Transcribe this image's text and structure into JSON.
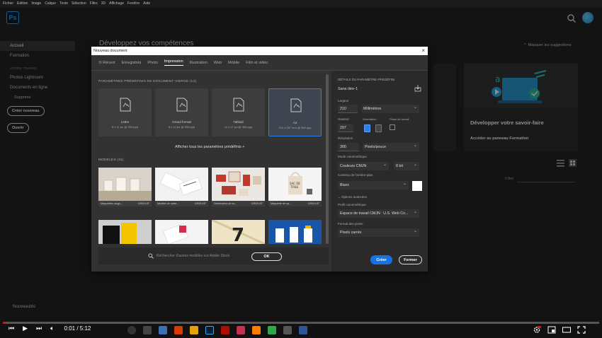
{
  "menubar": [
    "Fichier",
    "Edition",
    "Image",
    "Calque",
    "Texte",
    "Sélection",
    "Filtre",
    "3D",
    "Affichage",
    "Fenêtre",
    "Aide"
  ],
  "app": {
    "logo": "Ps",
    "accent": "#31a8ff"
  },
  "sidebar": {
    "home": "Accueil",
    "learn": "Formation",
    "section": "VOTRE TRAVAIL",
    "items": [
      "Photos Lightroom",
      "Documents en ligne"
    ],
    "deleted": "Supprimé",
    "create": "Créer nouveau",
    "open": "Ouvrir",
    "news": "Nouveautés"
  },
  "home": {
    "heading": "Développez vos compétences",
    "hide_suggestions": "Masquer les suggestions",
    "promo_title": "Développer votre savoir-faire",
    "promo_link": "Accéder au panneau Formation",
    "filter_label": "Filtre"
  },
  "dialog": {
    "title": "Nouveau document",
    "tabs": [
      "Récent",
      "Enregistrés",
      "Photo",
      "Impression",
      "Illustration",
      "Web",
      "Mobile",
      "Film et vidéo"
    ],
    "active_tab": "Impression",
    "presets_title": "PARAMÈTRES PRÉDÉFINIS DE DOCUMENT VIERGE (14)",
    "presets": [
      {
        "name": "Lettre",
        "dims": "8 x 11 po @ 300 ppp"
      },
      {
        "name": "Grand format",
        "dims": "8 x 14 po @ 300 ppp"
      },
      {
        "name": "Tabloid",
        "dims": "11 x 17 po @ 300 ppp"
      },
      {
        "name": "A4",
        "dims": "210 x 297 mm @ 300 ppp"
      }
    ],
    "show_all": "Afficher tous les paramètres prédéfinis +",
    "templates_title": "MODÈLES (31)",
    "templates": [
      {
        "name": "Maquettes mugs...",
        "tag": "GRATUIT"
      },
      {
        "name": "Modèle de carte...",
        "tag": "GRATUIT"
      },
      {
        "name": "Générateur de sc...",
        "tag": "GRATUIT"
      },
      {
        "name": "Maquette de sa...",
        "tag": "GRATUIT"
      }
    ],
    "stock_placeholder": "Rechercher d'autres modèles sur Adobe Stock",
    "ok": "OK",
    "details": {
      "section": "DÉTAILS DU PARAMÈTRE PRÉDÉFINI",
      "name": "Sans titre-1",
      "width_label": "Largeur",
      "width": "210",
      "unit": "Millimètres",
      "height_label": "Hauteur",
      "height": "297",
      "orientation_label": "Orientation",
      "artboards_label": "Plans de travail",
      "resolution_label": "Résolution",
      "resolution": "300",
      "res_unit": "Pixels/pouce",
      "color_mode_label": "Mode colorimétrique",
      "color_mode": "Couleurs CMJN",
      "bit_depth": "8 bit",
      "bg_label": "Contenu de l'arrière-plan",
      "bg": "Blanc",
      "advanced": "Options avancées",
      "profile_label": "Profil colorimétrique",
      "profile": "Espace de travail CMJN : U.S. Web Co...",
      "pixel_label": "Format des pixels",
      "pixel": "Pixels carrés",
      "create": "Créer",
      "close": "Fermer"
    }
  },
  "player": {
    "time": "0:01 / 5:12",
    "progress": 0.003
  }
}
